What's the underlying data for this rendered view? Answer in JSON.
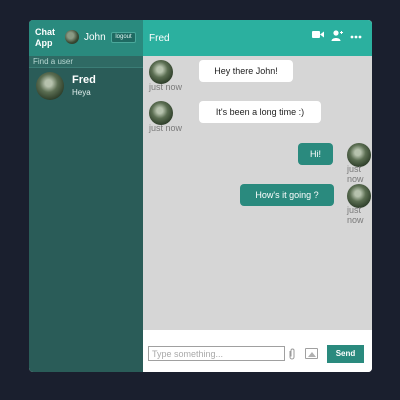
{
  "sidebar": {
    "app_title": "Chat App",
    "current_user": "John",
    "logout_label": "logout",
    "search_placeholder": "Find a user",
    "contacts": [
      {
        "name": "Fred",
        "last_message": "Heya"
      }
    ]
  },
  "chat": {
    "title": "Fred",
    "header_icons": [
      "video-camera-icon",
      "add-user-icon",
      "more-options-icon"
    ],
    "messages": [
      {
        "direction": "incoming",
        "text": "Hey there John!",
        "time": "just now"
      },
      {
        "direction": "incoming",
        "text": "It's been a long time :)",
        "time": "just now"
      },
      {
        "direction": "outgoing",
        "text": "Hi!",
        "time": "just now"
      },
      {
        "direction": "outgoing",
        "text": "How's it going ?",
        "time": "just now"
      }
    ],
    "composer": {
      "placeholder": "Type something...",
      "send_label": "Send"
    }
  },
  "colors": {
    "page_background": "#1a1f2e",
    "sidebar": "#2a5c58",
    "sidebar_header": "#2a8a7e",
    "chat_header": "#2bb09f",
    "chat_background": "#d6d6d6",
    "outgoing_bubble": "#2a8a7e",
    "incoming_bubble": "#ffffff"
  }
}
